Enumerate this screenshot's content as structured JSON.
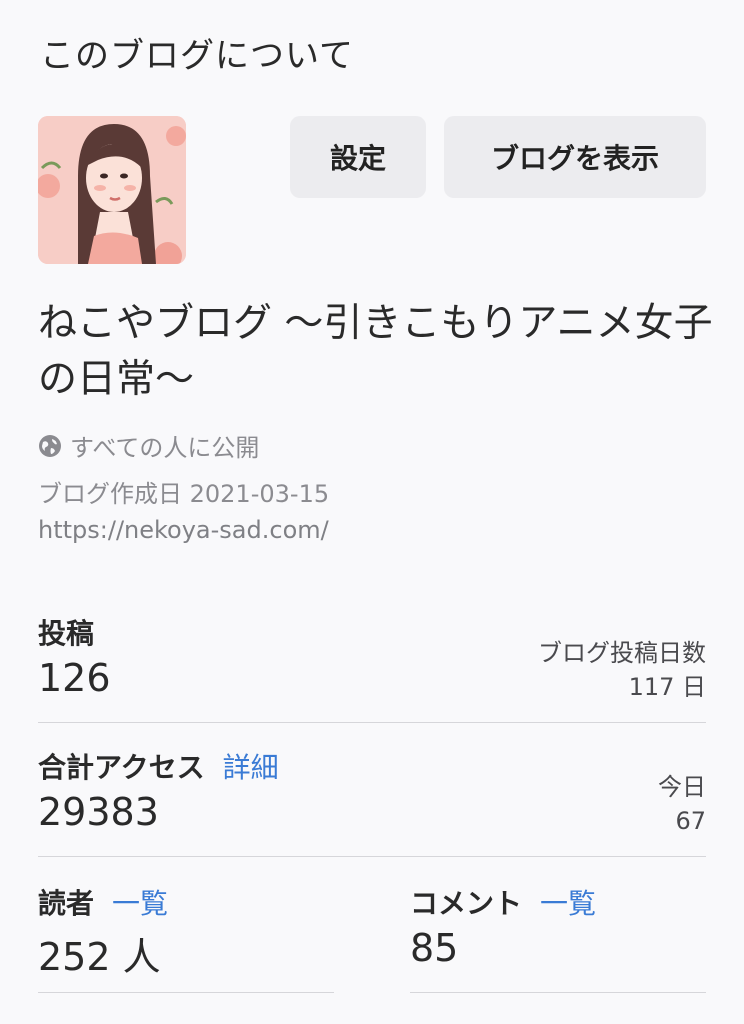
{
  "header": {
    "title": "このブログについて"
  },
  "buttons": {
    "settings": "設定",
    "view_blog": "ブログを表示"
  },
  "blog": {
    "title": "ねこやブログ 〜引きこもりアニメ女子の日常〜",
    "visibility": "すべての人に公開",
    "created": "ブログ作成日 2021-03-15",
    "url": "https://nekoya-sad.com/"
  },
  "stats": {
    "posts": {
      "label": "投稿",
      "value": "126",
      "side_label": "ブログ投稿日数",
      "side_value": "117 日"
    },
    "access": {
      "label": "合計アクセス",
      "link": "詳細",
      "value": "29383",
      "side_label": "今日",
      "side_value": "67"
    },
    "readers": {
      "label": "読者",
      "link": "一覧",
      "value": "252 人"
    },
    "comments": {
      "label": "コメント",
      "link": "一覧",
      "value": "85"
    }
  },
  "icons": {
    "visibility": "globe-icon",
    "avatar": "avatar-illustration"
  },
  "colors": {
    "link": "#3a7bd5",
    "button_bg": "#ececef",
    "background": "#f9f9fb"
  }
}
